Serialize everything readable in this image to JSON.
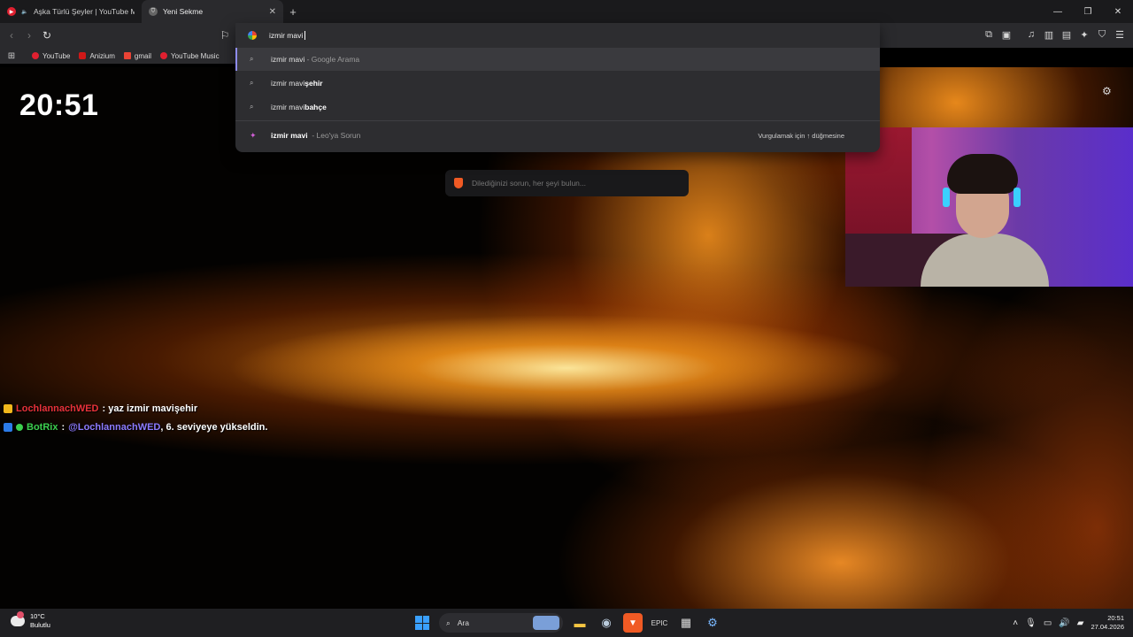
{
  "tabs": [
    {
      "title": "Aşka Türlü Şeyler | YouTube Music"
    },
    {
      "title": "Yeni Sekme"
    }
  ],
  "bookmarks": [
    {
      "label": "YouTube"
    },
    {
      "label": "Anizium"
    },
    {
      "label": "gmail"
    },
    {
      "label": "YouTube Music"
    }
  ],
  "omnibox": {
    "value": "izmir mavi",
    "suggestions": [
      {
        "bold": "izmir mavi",
        "rest": " - Google Arama"
      },
      {
        "plain": "izmir mavi",
        "bold": "şehir"
      },
      {
        "plain": "izmir mavi",
        "bold": "bahçe"
      }
    ],
    "leo": {
      "bold": "izmir mavi",
      "rest": "- Leo'ya Sorun",
      "hint": "Vurgulamak için ↑ düğmesine"
    }
  },
  "clock": "20:51",
  "leo_search": {
    "placeholder": "Dilediğinizi sorun, her şeyi bulun..."
  },
  "chat": [
    {
      "user": "LochlannachWED",
      "message": ": yaz izmir mavişehir"
    },
    {
      "user": "BotRix",
      "sep": ":",
      "mention": "@LochlannachWED",
      "message": ", 6. seviyeye yükseldin."
    }
  ],
  "taskbar": {
    "weather_temp": "10°C",
    "weather_desc": "Bulutlu",
    "search_label": "Ara",
    "time": "20:51",
    "date": "27.04.2026"
  },
  "colors": {
    "accent": "#8e8cf0",
    "chat_user1": "#e8323a",
    "chat_user2": "#3ccf4e",
    "mention": "#8c7bff"
  }
}
